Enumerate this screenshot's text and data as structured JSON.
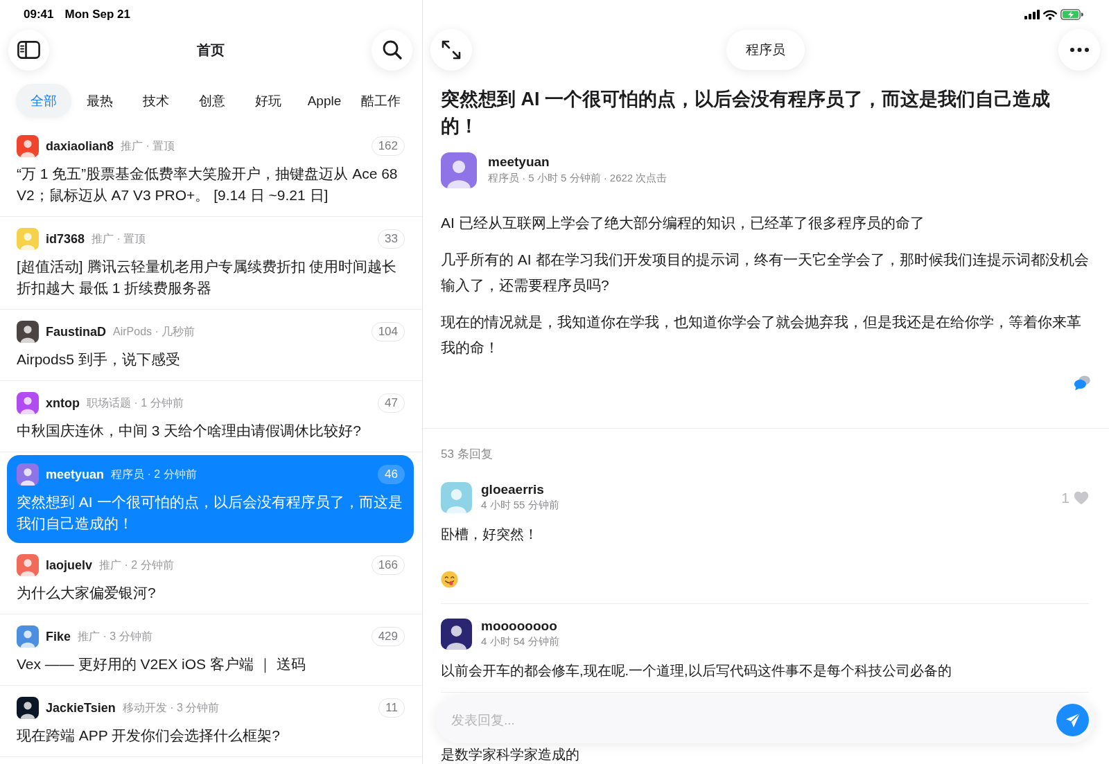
{
  "status_bar": {
    "time": "09:41",
    "date": "Mon Sep 21"
  },
  "sidebar": {
    "title": "首页",
    "tabs": [
      {
        "label": "全部",
        "selected": true
      },
      {
        "label": "最热",
        "selected": false
      },
      {
        "label": "技术",
        "selected": false
      },
      {
        "label": "创意",
        "selected": false
      },
      {
        "label": "好玩",
        "selected": false
      },
      {
        "label": "Apple",
        "selected": false
      },
      {
        "label": "酷工作",
        "selected": false
      }
    ],
    "topics": [
      {
        "username": "daxiaolian8",
        "meta": "推广 · 置顶",
        "replies": "162",
        "title": "“万 1 免五”股票基金低费率大笑脸开户，抽键盘迈从 Ace 68 V2；鼠标迈从 A7 V3 PRO+。 [9.14 日 ~9.21 日]",
        "avatar": {
          "color": "#f0442c"
        },
        "selected": false
      },
      {
        "username": "id7368",
        "meta": "推广 · 置顶",
        "replies": "33",
        "title": "[超值活动] 腾讯云轻量机老用户专属续费折扣 使用时间越长折扣越大 最低 1 折续费服务器",
        "avatar": {
          "color": "#f6d24a"
        },
        "selected": false
      },
      {
        "username": "FaustinaD",
        "meta": "AirPods · 几秒前",
        "replies": "104",
        "title": "Airpods5 到手，说下感受",
        "avatar": {
          "color": "#4a4442"
        },
        "selected": false
      },
      {
        "username": "xntop",
        "meta": "职场话题 · 1 分钟前",
        "replies": "47",
        "title": "中秋国庆连休，中间 3 天给个啥理由请假调休比较好?",
        "avatar": {
          "color": "#b04cf0"
        },
        "selected": false
      },
      {
        "username": "meetyuan",
        "meta": "程序员 · 2 分钟前",
        "replies": "46",
        "title": "突然想到 AI 一个很可怕的点，以后会没有程序员了，而这是我们自己造成的！",
        "avatar": {
          "color": "#8e74e6"
        },
        "selected": true
      },
      {
        "username": "laojuelv",
        "meta": "推广 · 2 分钟前",
        "replies": "166",
        "title": "为什么大家偏爱银河?",
        "avatar": {
          "color": "#f26a5a"
        },
        "selected": false
      },
      {
        "username": "Fike",
        "meta": "推广 · 3 分钟前",
        "replies": "429",
        "title": "Vex —— 更好用的 V2EX iOS 客户端 ｜ 送码",
        "avatar": {
          "color": "#4a8fe0"
        },
        "selected": false
      },
      {
        "username": "JackieTsien",
        "meta": "移动开发 · 3 分钟前",
        "replies": "11",
        "title": "现在跨端 APP 开发你们会选择什么框架?",
        "avatar": {
          "color": "#0b1626"
        },
        "selected": false
      }
    ]
  },
  "detail": {
    "node": "程序员",
    "title": "突然想到 AI 一个很可怕的点，以后会没有程序员了，而这是我们自己造成的！",
    "author": {
      "username": "meetyuan",
      "meta": "程序员 · 5 小时 5 分钟前 · 2622 次点击",
      "avatar": {
        "color": "#8e74e6"
      }
    },
    "paragraphs": [
      "AI 已经从互联网上学会了绝大部分编程的知识，已经革了很多程序员的命了",
      "几乎所有的 AI 都在学习我们开发项目的提示词，终有一天它全学会了，那时候我们连提示词都没机会输入了，还需要程序员吗?",
      "现在的情况就是，我知道你在学我，也知道你学会了就会抛弃我，但是我还是在给你学，等着你来革我的命！"
    ],
    "reply_total": "53 条回复",
    "replies": [
      {
        "username": "gloeaerris",
        "time": "4 小时 55 分钟前",
        "content": "卧槽，好突然！",
        "sticker": true,
        "like": {
          "count": "1",
          "liked": false
        },
        "avatar": {
          "color": "#8fd4e6"
        }
      },
      {
        "username": "moooooooo",
        "time": "4 小时 54 分钟前",
        "content": "以前会开车的都会修车,现在呢.一个道理,以后写代码这件事不是每个科技公司必备的",
        "sticker": false,
        "avatar": {
          "color": "#2b2672"
        }
      },
      {
        "content": "是数学家科学家造成的",
        "sticker": false
      }
    ],
    "composer": {
      "placeholder": "发表回复..."
    }
  }
}
